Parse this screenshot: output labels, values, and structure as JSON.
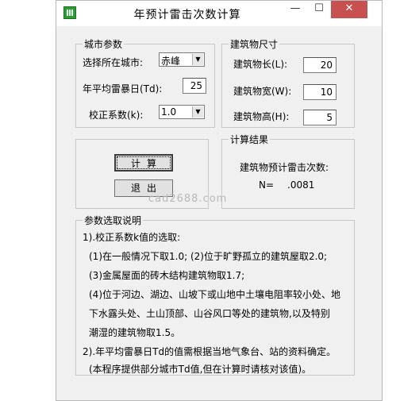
{
  "window": {
    "title": "年预计雷击次数计算",
    "min": "—",
    "max": "☐",
    "close": "✕"
  },
  "city_params": {
    "legend": "城市参数",
    "city_label": "选择所在城市:",
    "city_value": "赤峰",
    "td_label": "年平均雷暴日(Td):",
    "td_value": "25",
    "k_label": "校正系数(k):",
    "k_value": "1.0"
  },
  "building": {
    "legend": "建筑物尺寸",
    "length_label": "建筑物长(L):",
    "length_value": "20",
    "width_label": "建筑物宽(W):",
    "width_value": "10",
    "height_label": "建筑物高(H):",
    "height_value": "5"
  },
  "actions": {
    "calc_label": "计算",
    "exit_label": "退出"
  },
  "result": {
    "legend": "计算结果",
    "heading": "建筑物预计雷击次数:",
    "n_label": "N=",
    "n_value": ".0081"
  },
  "watermark": "cad2688.com",
  "notes": {
    "legend": "参数选取说明",
    "lines": [
      "1).校正系数k值的选取:",
      "(1)在一般情况下取1.0;     (2)位于旷野孤立的建筑屋取2.0;",
      "(3)金属屋面的砖木结构建筑物取1.7;",
      "(4)位于河边、湖边、山坡下或山地中土壤电阻率较小处、地",
      "下水露头处、土山顶部、山谷风口等处的建筑物,以及特别",
      "潮湿的建筑物取1.5。",
      "2).年平均雷暴日Td的值需根据当地气象台、站的资料确定。",
      "(本程序提供部分城市Td值,但在计算时请核对该值)。"
    ]
  }
}
